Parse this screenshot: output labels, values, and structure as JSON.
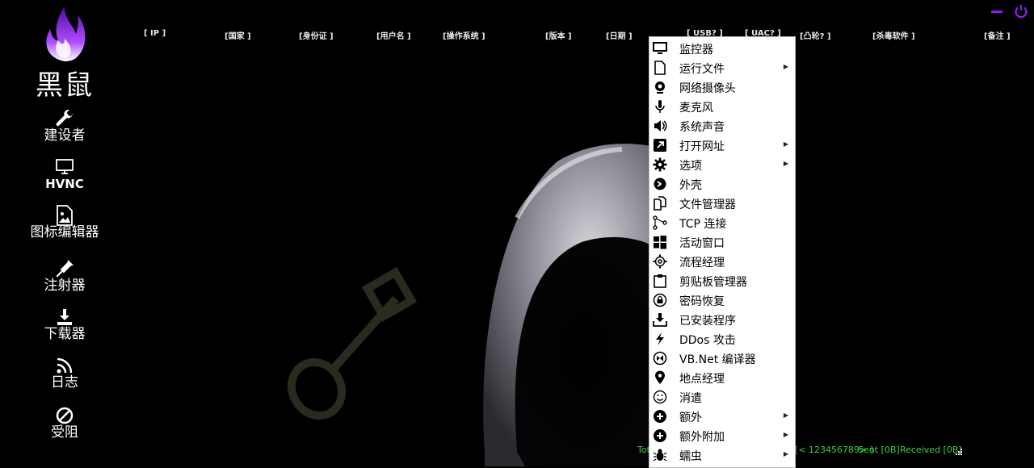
{
  "app": {
    "logo_text": "黑鼠"
  },
  "sidebar": {
    "items": [
      {
        "label": "建设者",
        "icon": "wrench-icon"
      },
      {
        "label": "HVNC",
        "icon": "monitor-icon"
      },
      {
        "label": "图标编辑器",
        "icon": "image-file-icon"
      },
      {
        "label": "注射器",
        "icon": "syringe-icon"
      },
      {
        "label": "下载器",
        "icon": "download-icon"
      },
      {
        "label": "日志",
        "icon": "rss-icon"
      },
      {
        "label": "受阻",
        "icon": "blocked-icon"
      }
    ]
  },
  "header": {
    "columns": [
      "[ IP ]",
      "[国家 ]",
      "[身份证 ]",
      "[用户名 ]",
      "[操作系统 ]",
      "[版本 ]",
      "[日期 ]",
      "[ USB? ]",
      "[ UAC? ]",
      "[凸轮? ]",
      "[杀毒软件 ]",
      "[备注 ]"
    ]
  },
  "menu": {
    "items": [
      {
        "label": "监控器",
        "icon": "monitor-icon",
        "submenu": false
      },
      {
        "label": "运行文件",
        "icon": "file-icon",
        "submenu": true
      },
      {
        "label": "网络摄像头",
        "icon": "webcam-icon",
        "submenu": false
      },
      {
        "label": "麦克风",
        "icon": "microphone-icon",
        "submenu": false
      },
      {
        "label": "系统声音",
        "icon": "speaker-icon",
        "submenu": false
      },
      {
        "label": "打开网址",
        "icon": "external-link-icon",
        "submenu": true
      },
      {
        "label": "选项",
        "icon": "gear-icon",
        "submenu": true
      },
      {
        "label": "外壳",
        "icon": "terminal-icon",
        "submenu": false
      },
      {
        "label": "文件管理器",
        "icon": "files-icon",
        "submenu": false
      },
      {
        "label": "TCP 连接",
        "icon": "network-nodes-icon",
        "submenu": false
      },
      {
        "label": "活动窗口",
        "icon": "windows-icon",
        "submenu": false
      },
      {
        "label": "流程经理",
        "icon": "cog-outline-icon",
        "submenu": false
      },
      {
        "label": "剪贴板管理器",
        "icon": "clipboard-icon",
        "submenu": false
      },
      {
        "label": "密码恢复",
        "icon": "lock-icon",
        "submenu": false
      },
      {
        "label": "已安装程序",
        "icon": "install-icon",
        "submenu": false
      },
      {
        "label": "DDos 攻击",
        "icon": "lightning-icon",
        "submenu": false
      },
      {
        "label": "VB.Net 编译器",
        "icon": "visual-studio-icon",
        "submenu": false
      },
      {
        "label": "地点经理",
        "icon": "map-pin-icon",
        "submenu": false
      },
      {
        "label": "消遣",
        "icon": "smiley-icon",
        "submenu": false
      },
      {
        "label": "额外",
        "icon": "plus-circle-icon",
        "submenu": true
      },
      {
        "label": "额外附加",
        "icon": "plus-circle-icon",
        "submenu": true
      },
      {
        "label": "蠕虫",
        "icon": "bug-icon",
        "submenu": true
      }
    ]
  },
  "status": {
    "left": "Tot",
    "port": "[< 123456789> ]",
    "sent": "Sent [0B]",
    "received": "Received [0B]"
  },
  "colors": {
    "accent": "#8a1cf0",
    "status_green": "#3fd13f"
  }
}
